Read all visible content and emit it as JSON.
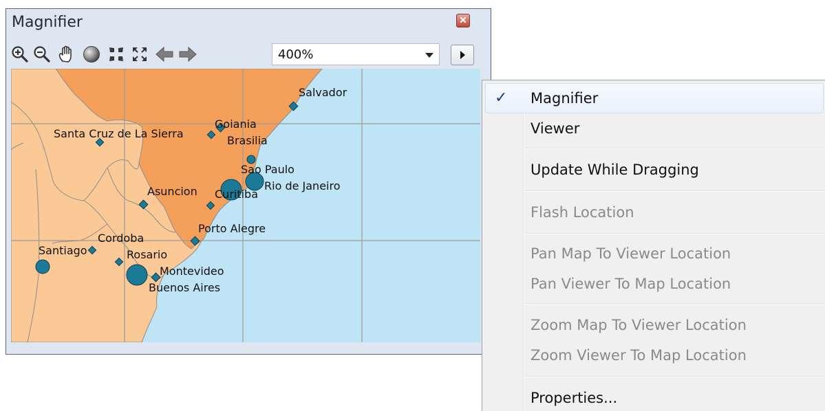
{
  "window": {
    "title": "Magnifier",
    "close_icon": "close-icon",
    "toolbar": {
      "zoom_value": "400%",
      "buttons": [
        "zoom-in-icon",
        "zoom-out-icon",
        "pan-hand-icon",
        "full-extent-globe-icon",
        "fixed-zoom-in-icon",
        "fixed-zoom-out-icon",
        "back-arrow-icon",
        "forward-arrow-icon"
      ]
    }
  },
  "map": {
    "colors": {
      "water": "#bee4f6",
      "highlighted_country": "#f4a05a",
      "land": "#fbc995",
      "city": "#1b7a98"
    },
    "cities": [
      "Salvador",
      "Goiania",
      "Santa Cruz de La Sierra",
      "Brasilia",
      "Sao Paulo",
      "Rio de Janeiro",
      "Asuncion",
      "Curitiba",
      "Porto Alegre",
      "Cordoba",
      "Santiago",
      "Rosario",
      "Montevideo",
      "Buenos Aires"
    ]
  },
  "context_menu": {
    "checked_item": "Magnifier",
    "items": {
      "magnifier": "Magnifier",
      "viewer": "Viewer",
      "update_while_dragging": "Update While Dragging",
      "flash_location": "Flash Location",
      "pan_map_to_viewer": "Pan Map To Viewer Location",
      "pan_viewer_to_map": "Pan Viewer To Map Location",
      "zoom_map_to_viewer": "Zoom Map To Viewer Location",
      "zoom_viewer_to_map": "Zoom Viewer To Map Location",
      "properties": "Properties..."
    }
  }
}
